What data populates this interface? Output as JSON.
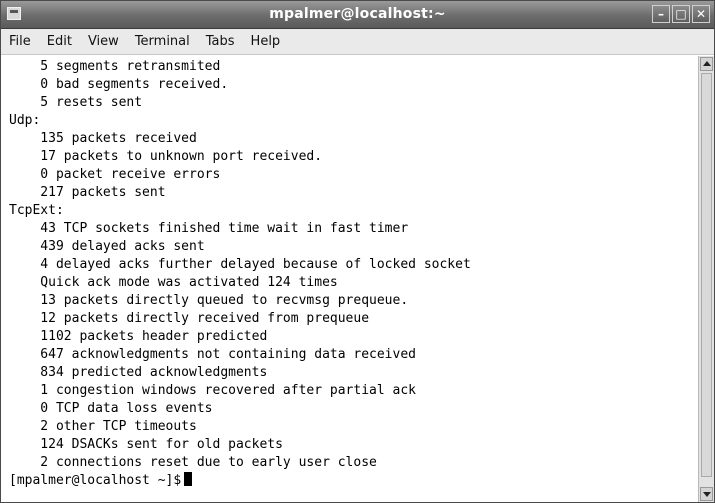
{
  "window": {
    "title": "mpalmer@localhost:~",
    "buttons": {
      "minimize": "–",
      "maximize": "□",
      "close": "✕"
    }
  },
  "menu": {
    "file": "File",
    "edit": "Edit",
    "view": "View",
    "terminal": "Terminal",
    "tabs": "Tabs",
    "help": "Help"
  },
  "terminal": {
    "lines": [
      "    5 segments retransmited",
      "    0 bad segments received.",
      "    5 resets sent",
      "Udp:",
      "    135 packets received",
      "    17 packets to unknown port received.",
      "    0 packet receive errors",
      "    217 packets sent",
      "TcpExt:",
      "    43 TCP sockets finished time wait in fast timer",
      "    439 delayed acks sent",
      "    4 delayed acks further delayed because of locked socket",
      "    Quick ack mode was activated 124 times",
      "    13 packets directly queued to recvmsg prequeue.",
      "    12 packets directly received from prequeue",
      "    1102 packets header predicted",
      "    647 acknowledgments not containing data received",
      "    834 predicted acknowledgments",
      "    1 congestion windows recovered after partial ack",
      "    0 TCP data loss events",
      "    2 other TCP timeouts",
      "    124 DSACKs sent for old packets",
      "    2 connections reset due to early user close"
    ],
    "prompt": "[mpalmer@localhost ~]$"
  },
  "icons": {
    "window_menu": "window-menu-icon",
    "scroll_up": "arrow-up-icon",
    "scroll_down": "arrow-down-icon"
  }
}
